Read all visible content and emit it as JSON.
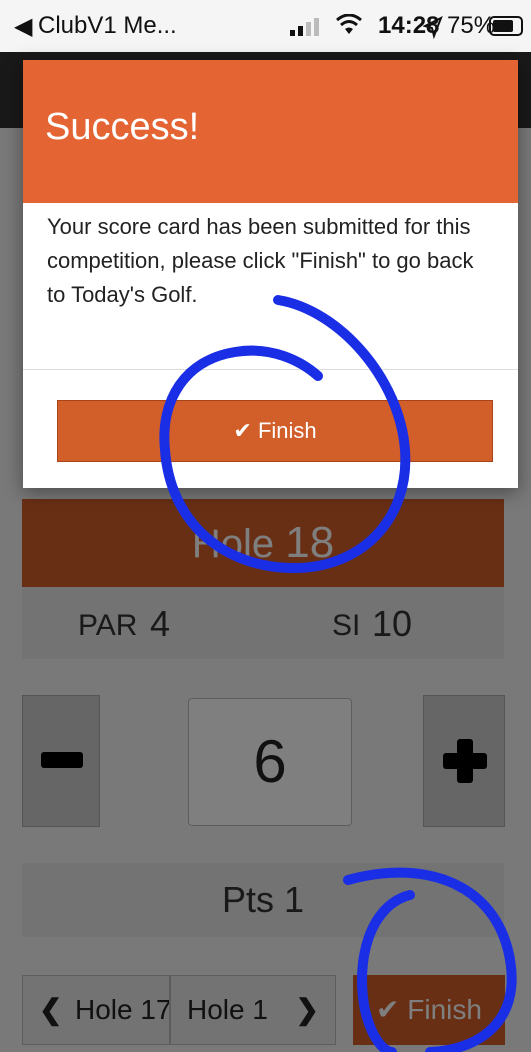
{
  "status_bar": {
    "back_arrow": "◀",
    "app_name": "ClubV1 Me...",
    "time": "14:28",
    "location_icon": "location-arrow-icon",
    "battery": "75%"
  },
  "modal": {
    "title": "Success!",
    "message": "Your score card has been submitted for this competition, please click \"Finish\" to go back to Today's Golf.",
    "finish_label": "Finish",
    "check_icon": "✔"
  },
  "hole": {
    "label": "Hole",
    "number": "18",
    "par_label": "PAR",
    "par_value": "4",
    "si_label": "SI",
    "si_value": "10"
  },
  "score": {
    "value": "6",
    "points": "Pts 1"
  },
  "navigation": {
    "prev_label": "Hole 17",
    "next_label": "Hole 1",
    "prev_chevron": "❮",
    "next_chevron": "❯",
    "finish_label": "Finish",
    "finish_icon": "✔"
  },
  "colors": {
    "accent_orange": "#e46433",
    "button_orange": "#d25e2a",
    "scribble_blue": "#1a2ee6"
  }
}
